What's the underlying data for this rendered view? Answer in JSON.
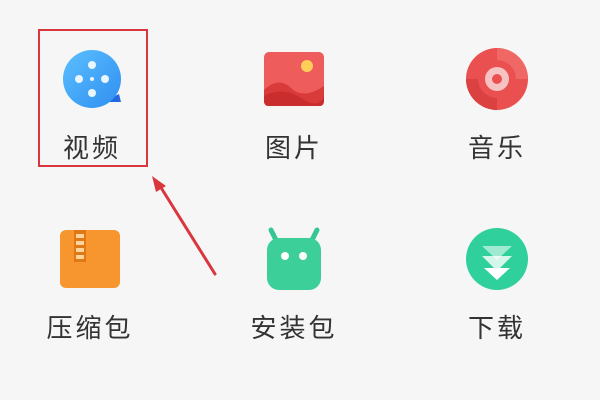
{
  "apps": [
    {
      "label": "视频",
      "icon": "video-icon"
    },
    {
      "label": "图片",
      "icon": "image-icon"
    },
    {
      "label": "音乐",
      "icon": "music-icon"
    },
    {
      "label": "压缩包",
      "icon": "archive-icon"
    },
    {
      "label": "安装包",
      "icon": "android-package-icon"
    },
    {
      "label": "下载",
      "icon": "download-icon"
    }
  ],
  "colors": {
    "video": "#3aa3f2",
    "image": "#ec4b4b",
    "music": "#e8504f",
    "archive": "#f5922e",
    "package": "#3ccf9a",
    "download": "#2fd09c",
    "highlight": "#d9363e",
    "label": "#333333"
  }
}
